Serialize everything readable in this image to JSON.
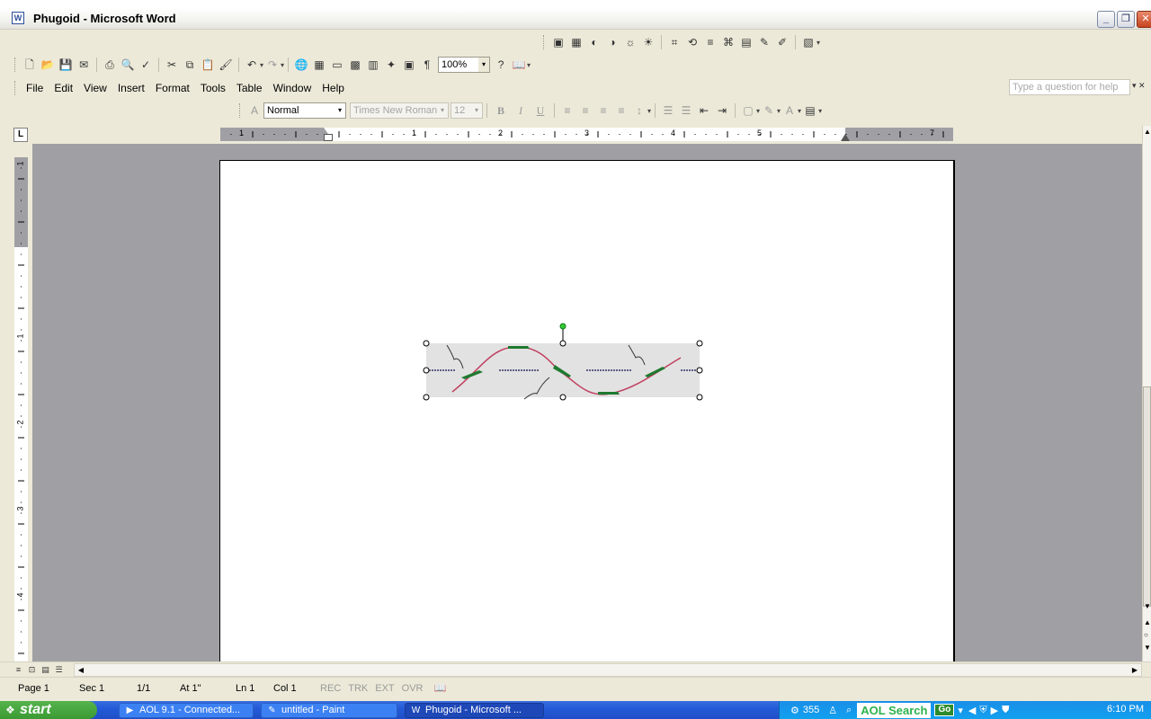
{
  "window": {
    "title": "Phugoid - Microsoft Word",
    "icon": "word-document-icon",
    "buttons": [
      "_",
      "❐",
      "✕"
    ]
  },
  "standard_toolbar": {
    "zoom": "100%"
  },
  "menubar": {
    "items": [
      "File",
      "Edit",
      "View",
      "Insert",
      "Format",
      "Tools",
      "Table",
      "Window",
      "Help"
    ]
  },
  "help_box": {
    "placeholder": "Type a question for help"
  },
  "formatting_toolbar": {
    "style": "Normal",
    "font": "Times New Roman",
    "size": "12",
    "bold": "B",
    "italic": "I",
    "underline": "U"
  },
  "ruler": {
    "labels": [
      "1",
      "1",
      "2",
      "3",
      "4",
      "5",
      "7"
    ],
    "vertical_labels": [
      "1",
      "1",
      "2",
      "3",
      "4"
    ],
    "tab_selector": "L"
  },
  "status": {
    "page": "Page 1",
    "section": "Sec 1",
    "page_of": "1/1",
    "at": "At 1\"",
    "line": "Ln 1",
    "col": "Col 1",
    "rec": "REC",
    "trk": "TRK",
    "ext": "EXT",
    "ovr": "OVR"
  },
  "taskbar": {
    "start": "start",
    "tasks": [
      "AOL 9.1 - Connected...",
      "untitled - Paint",
      "Phugoid - Microsoft ..."
    ],
    "tray_count": "355",
    "aol_search": "AOL Search",
    "go": "Go",
    "time": "6:10 PM"
  },
  "colors": {
    "accent_title": "#245ad8",
    "start_green": "#3b9a33",
    "curve": "#c04060",
    "plane": "#1f7a2f"
  }
}
